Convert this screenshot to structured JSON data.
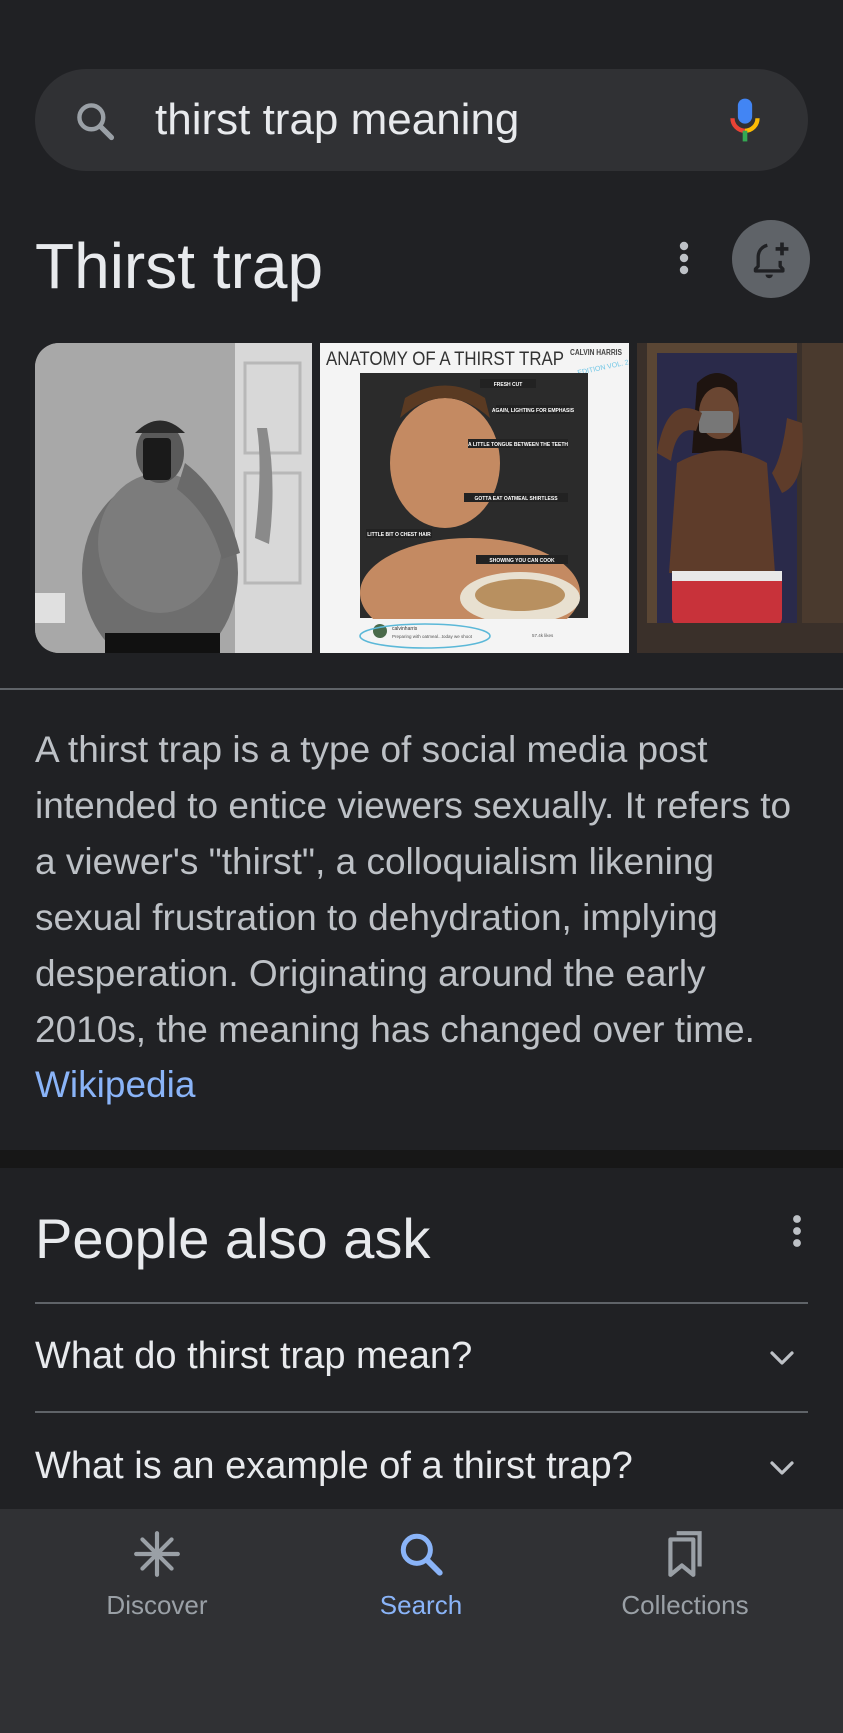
{
  "search": {
    "query": "thirst trap meaning"
  },
  "knowledge_panel": {
    "title": "Thirst trap",
    "description": "A thirst trap is a type of social media post intended to entice viewers sexually. It refers to a viewer's \"thirst\", a colloquialism likening sexual frustration to dehydration, implying desperation. Originating around the early 2010s, the meaning has changed over time.",
    "source": "Wikipedia",
    "images": [
      {
        "name": "image-mirror-selfie-bw"
      },
      {
        "name": "image-anatomy-infographic",
        "header": "ANATOMY OF A THIRST TRAP",
        "brand": "CALVIN HARRIS",
        "edition": "EDITION VOL. 2",
        "callouts": [
          "FRESH CUT",
          "AGAIN, LIGHTING FOR EMPHASIS",
          "A LITTLE TONGUE BETWEEN THE TEETH",
          "GOTTA EAT OATMEAL SHIRTLESS",
          "LITTLE BIT O CHEST HAIR",
          "SHOWING YOU CAN COOK"
        ],
        "caption_user": "calvinharris",
        "caption_text": "Preparing with oatmeal...today we shoot",
        "caption_likes": "57.4k likes"
      },
      {
        "name": "image-mirror-selfie-tattoos"
      }
    ]
  },
  "people_also_ask": {
    "title": "People also ask",
    "questions": [
      "What do thirst trap mean?",
      "What is an example of a thirst trap?"
    ]
  },
  "bottom_nav": {
    "items": [
      {
        "label": "Discover",
        "icon": "asterisk-icon",
        "active": false
      },
      {
        "label": "Search",
        "icon": "search-icon",
        "active": true
      },
      {
        "label": "Collections",
        "icon": "collections-icon",
        "active": false
      }
    ]
  },
  "colors": {
    "background": "#202124",
    "surface": "#303134",
    "link": "#8ab4f8",
    "text_primary": "#e8eaed",
    "text_secondary": "#bdc1c6"
  }
}
